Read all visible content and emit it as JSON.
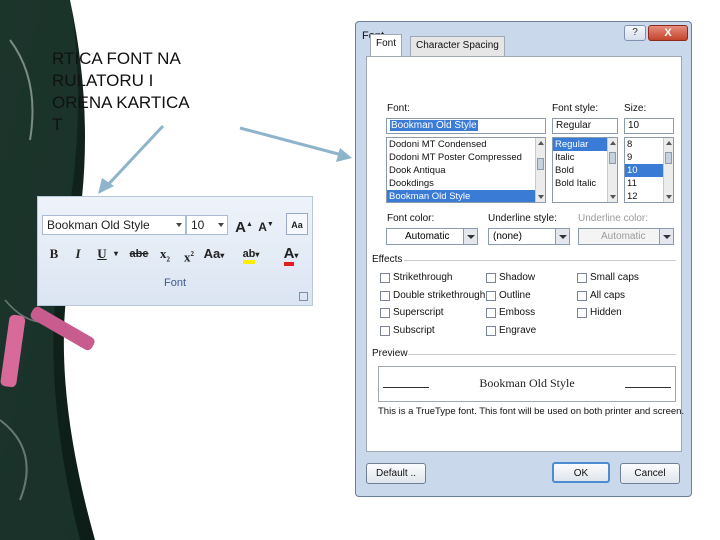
{
  "slide": {
    "lines": [
      "RTICA FONT NA",
      "RULATORU  I",
      "ORENA KARTICA",
      "T"
    ]
  },
  "ribbon": {
    "font_name": "Bookman Old Style",
    "font_size": "10",
    "grow_label": "A",
    "shrink_label": "A",
    "bold": "B",
    "italic": "I",
    "underline": "U",
    "strikethrough": "abe",
    "subscript": "x",
    "superscript": "x",
    "change_case": "Aa",
    "highlight": "ab",
    "font_color_label": "A",
    "group_label": "Font"
  },
  "dialog": {
    "title": "Font",
    "help": "?",
    "close": "X",
    "tabs": [
      {
        "label": "Font",
        "active": true
      },
      {
        "label": "Character Spacing",
        "active": false
      }
    ],
    "font_label": "Font:",
    "font_value": "Bookman Old Style",
    "font_list": [
      "Dodoni MT Condensed",
      "Dodoni MT Poster Compressed",
      "Dook Antiqua",
      "Dookdings",
      "Bookman Old Style"
    ],
    "font_selected_index": 4,
    "style_label": "Font style:",
    "style_value": "Regular",
    "style_list": [
      "Regular",
      "Italic",
      "Bold",
      "Bold Italic"
    ],
    "style_selected_index": 0,
    "size_label": "Size:",
    "size_value": "10",
    "size_list": [
      "8",
      "9",
      "10",
      "11",
      "12"
    ],
    "size_selected_index": 2,
    "font_color_label": "Font color:",
    "font_color_value": "Automatic",
    "underline_style_label": "Underline style:",
    "underline_style_value": "(none)",
    "underline_color_label": "Underline color:",
    "underline_color_value": "Automatic",
    "effects_label": "Effects",
    "effects_col1": [
      "Strikethrough",
      "Double strikethrough",
      "Superscript",
      "Subscript"
    ],
    "effects_col2": [
      "Shadow",
      "Outline",
      "Emboss",
      "Engrave"
    ],
    "effects_col3": [
      "Small caps",
      "All caps",
      "Hidden"
    ],
    "preview_label": "Preview",
    "preview_text": "Bookman Old Style",
    "preview_note": "This is a TrueType font. This font will be used on both printer and screen.",
    "default_button": "Default ..",
    "ok_button": "OK",
    "cancel_button": "Cancel"
  },
  "colors": {
    "accent": "#3a7bd5",
    "chalk_pink": "#d86a9a",
    "board_dark": "#0e1f1a",
    "arrow_blue": "#8eb4cc"
  }
}
